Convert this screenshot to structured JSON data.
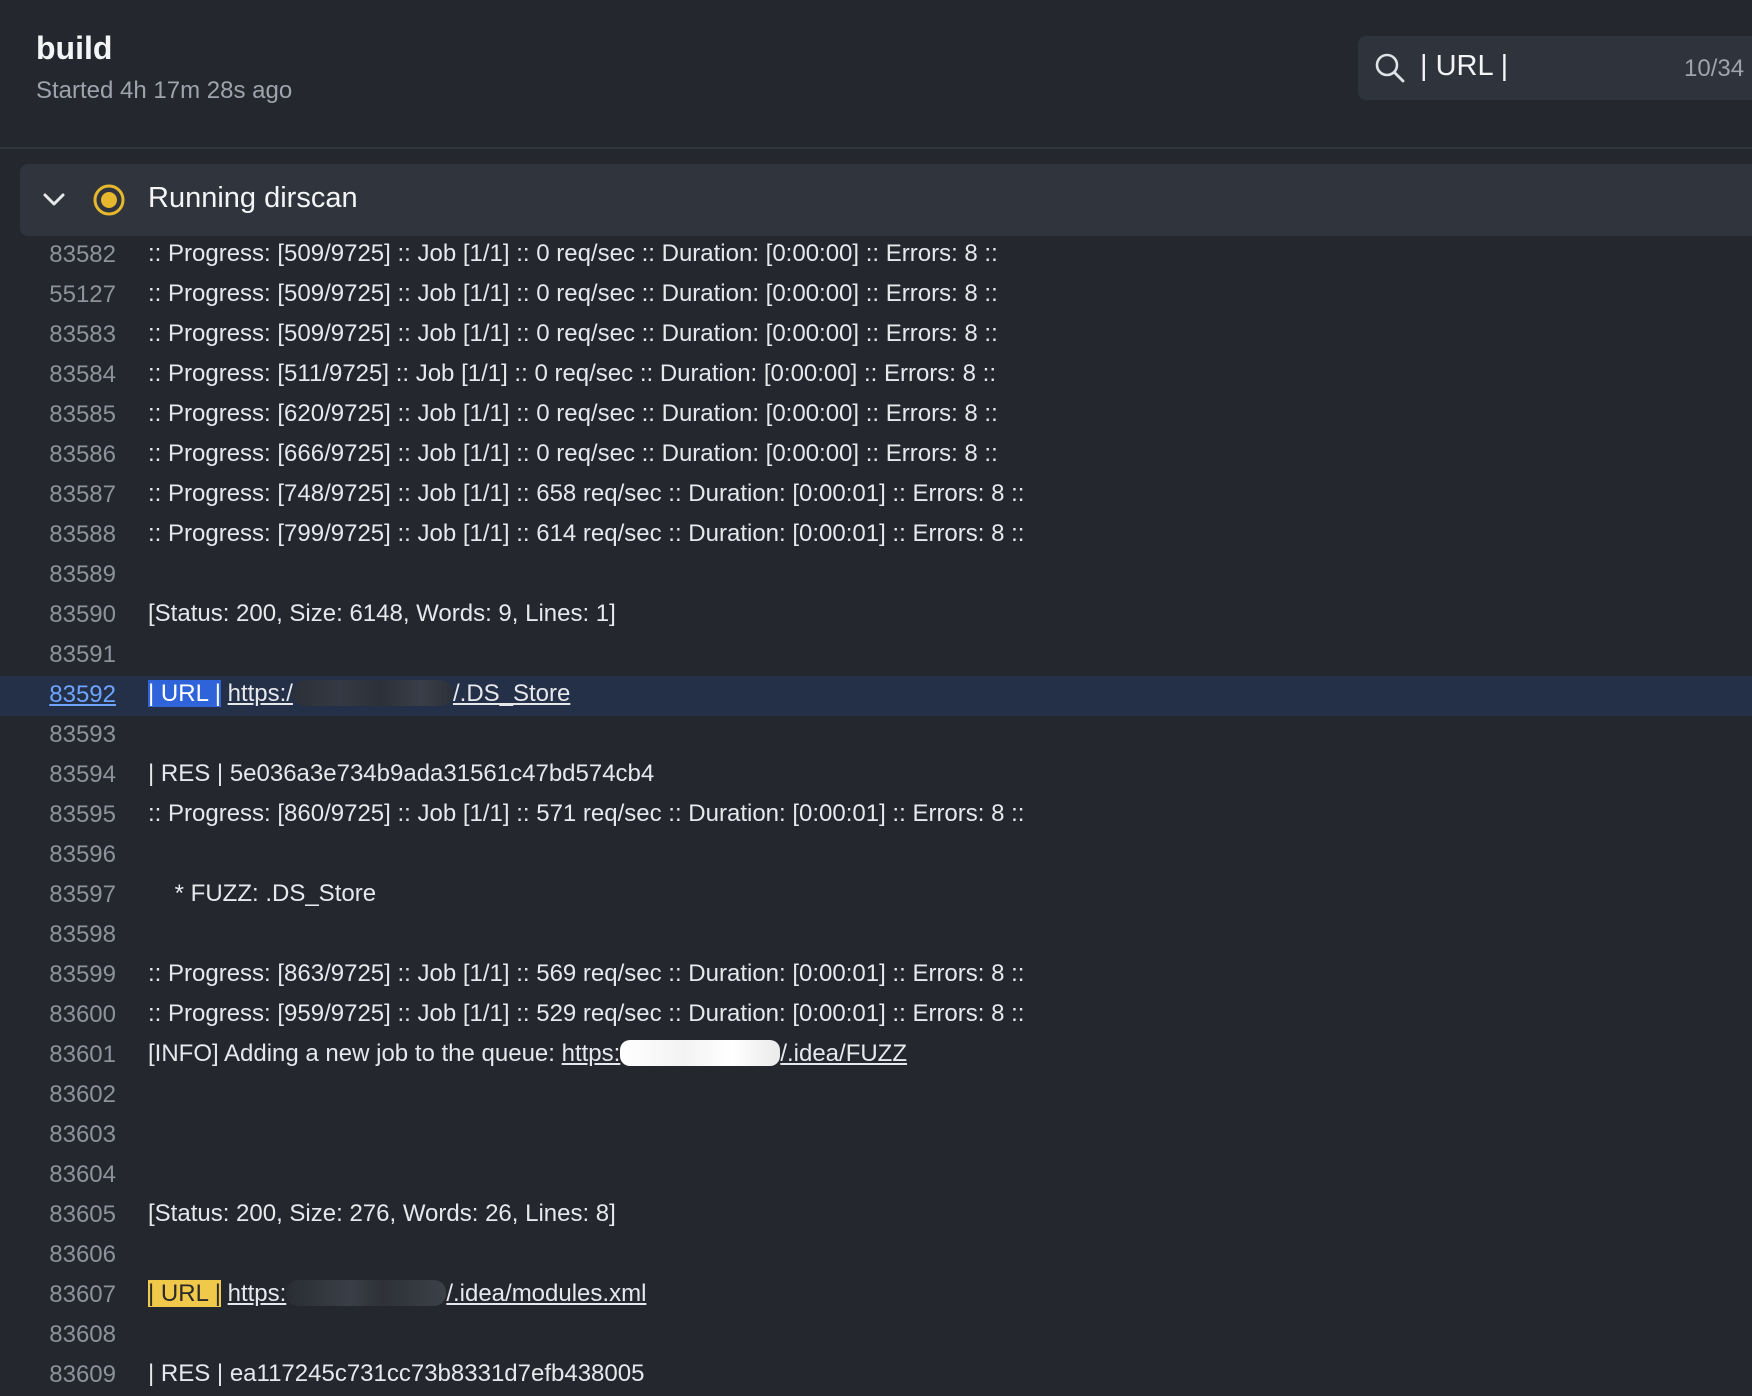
{
  "header": {
    "title": "build",
    "subtitle": "Started 4h 17m 28s ago"
  },
  "search": {
    "query": "| URL |",
    "count": "10/34",
    "icon": "search-icon"
  },
  "step": {
    "name": "Running dirscan",
    "status": "running",
    "status_color": "#e6b82e",
    "icons": [
      "chevron-down-icon",
      "running-status-icon"
    ]
  },
  "log": {
    "lines": [
      {
        "num": "83582",
        "text": ":: Progress: [509/9725] :: Job [1/1] :: 0 req/sec :: Duration: [0:00:00] :: Errors: 8 ::"
      },
      {
        "num": "55127",
        "text": ":: Progress: [509/9725] :: Job [1/1] :: 0 req/sec :: Duration: [0:00:00] :: Errors: 8 ::"
      },
      {
        "num": "83583",
        "text": ":: Progress: [509/9725] :: Job [1/1] :: 0 req/sec :: Duration: [0:00:00] :: Errors: 8 ::"
      },
      {
        "num": "83584",
        "text": ":: Progress: [511/9725] :: Job [1/1] :: 0 req/sec :: Duration: [0:00:00] :: Errors: 8 ::"
      },
      {
        "num": "83585",
        "text": ":: Progress: [620/9725] :: Job [1/1] :: 0 req/sec :: Duration: [0:00:00] :: Errors: 8 ::"
      },
      {
        "num": "83586",
        "text": ":: Progress: [666/9725] :: Job [1/1] :: 0 req/sec :: Duration: [0:00:00] :: Errors: 8 ::"
      },
      {
        "num": "83587",
        "text": ":: Progress: [748/9725] :: Job [1/1] :: 658 req/sec :: Duration: [0:00:01] :: Errors: 8 ::"
      },
      {
        "num": "83588",
        "text": ":: Progress: [799/9725] :: Job [1/1] :: 614 req/sec :: Duration: [0:00:01] :: Errors: 8 ::"
      },
      {
        "num": "83589",
        "text": ""
      },
      {
        "num": "83590",
        "text": "[Status: 200, Size: 6148, Words: 9, Lines: 1]"
      },
      {
        "num": "83591",
        "text": ""
      },
      {
        "num": "83592",
        "mark": "| URL |",
        "mark_type": "current",
        "link_prefix": "https:/",
        "link_suffix": "/.DS_Store",
        "active": true
      },
      {
        "num": "83593",
        "text": ""
      },
      {
        "num": "83594",
        "text": "| RES | 5e036a3e734b9ada31561c47bd574cb4"
      },
      {
        "num": "83595",
        "text": ":: Progress: [860/9725] :: Job [1/1] :: 571 req/sec :: Duration: [0:00:01] :: Errors: 8 ::"
      },
      {
        "num": "83596",
        "text": ""
      },
      {
        "num": "83597",
        "text": "    * FUZZ: .DS_Store"
      },
      {
        "num": "83598",
        "text": ""
      },
      {
        "num": "83599",
        "text": ":: Progress: [863/9725] :: Job [1/1] :: 569 req/sec :: Duration: [0:00:01] :: Errors: 8 ::"
      },
      {
        "num": "83600",
        "text": ":: Progress: [959/9725] :: Job [1/1] :: 529 req/sec :: Duration: [0:00:01] :: Errors: 8 ::"
      },
      {
        "num": "83601",
        "prefix": "[INFO] Adding a new job to the queue: ",
        "link_prefix": "https:",
        "link_suffix": "/.idea/FUZZ",
        "redact": "light"
      },
      {
        "num": "83602",
        "text": ""
      },
      {
        "num": "83603",
        "text": ""
      },
      {
        "num": "83604",
        "text": ""
      },
      {
        "num": "83605",
        "text": "[Status: 200, Size: 276, Words: 26, Lines: 8]"
      },
      {
        "num": "83606",
        "text": ""
      },
      {
        "num": "83607",
        "mark": "| URL |",
        "mark_type": "match",
        "link_prefix": "https:",
        "link_suffix": "/.idea/modules.xml",
        "redact": "dark"
      },
      {
        "num": "83608",
        "text": ""
      },
      {
        "num": "83609",
        "text": "| RES | ea117245c731cc73b8331d7efb438005"
      }
    ]
  }
}
